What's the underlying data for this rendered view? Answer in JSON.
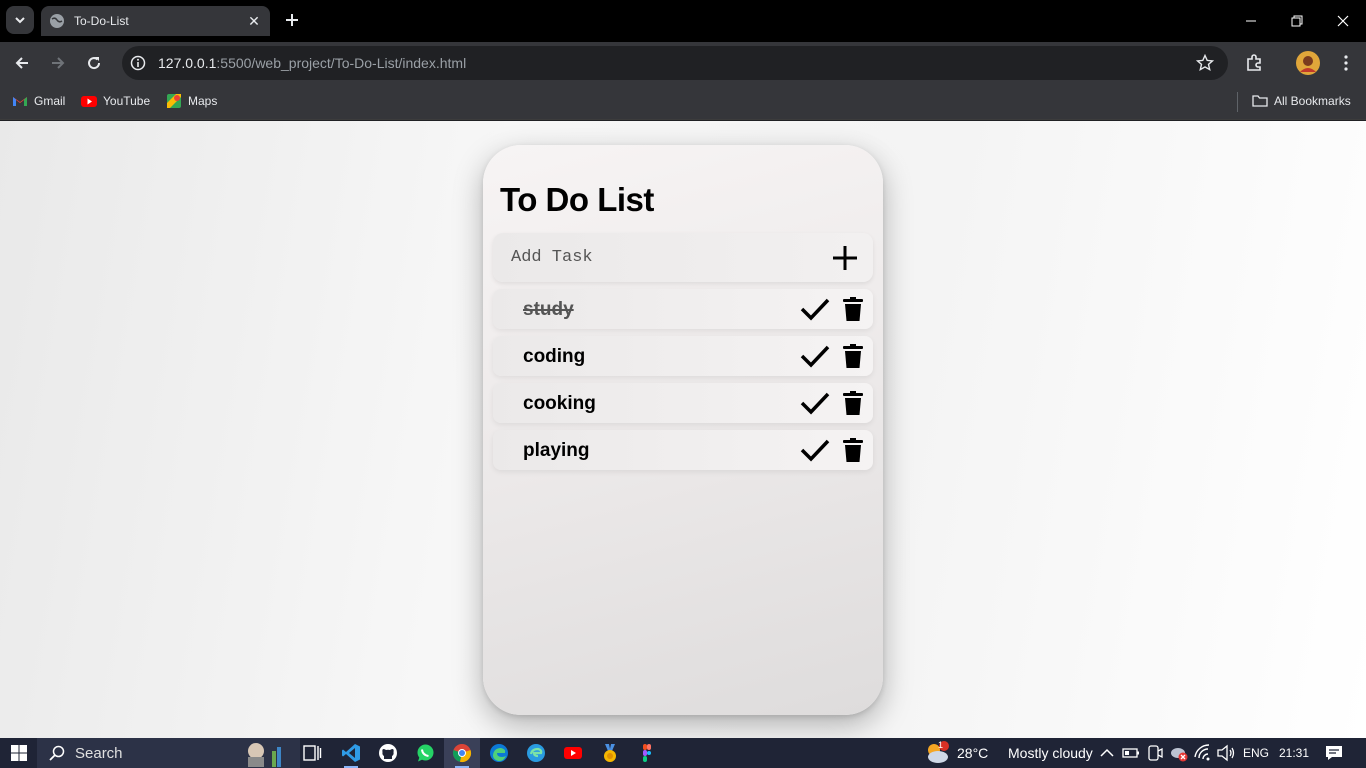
{
  "browser": {
    "tab_title": "To-Do-List",
    "url_host": "127.0.0.1",
    "url_path": ":5500/web_project/To-Do-List/index.html",
    "bookmarks": [
      {
        "label": "Gmail",
        "icon": "gmail-icon"
      },
      {
        "label": "YouTube",
        "icon": "youtube-icon"
      },
      {
        "label": "Maps",
        "icon": "maps-icon"
      }
    ],
    "all_bookmarks": "All Bookmarks"
  },
  "app": {
    "title": "To Do List",
    "add_placeholder": "Add Task",
    "tasks": [
      {
        "name": "study",
        "completed": true
      },
      {
        "name": "coding",
        "completed": false
      },
      {
        "name": "cooking",
        "completed": false
      },
      {
        "name": "playing",
        "completed": false
      }
    ]
  },
  "taskbar": {
    "search_label": "Search",
    "temperature": "28°C",
    "weather": "Mostly cloudy",
    "weather_badge": "1",
    "language": "ENG",
    "time": "21:31"
  },
  "colors": {
    "tab_bar": "#000000",
    "toolbar": "#35363a",
    "taskbar": "#1f2436"
  }
}
